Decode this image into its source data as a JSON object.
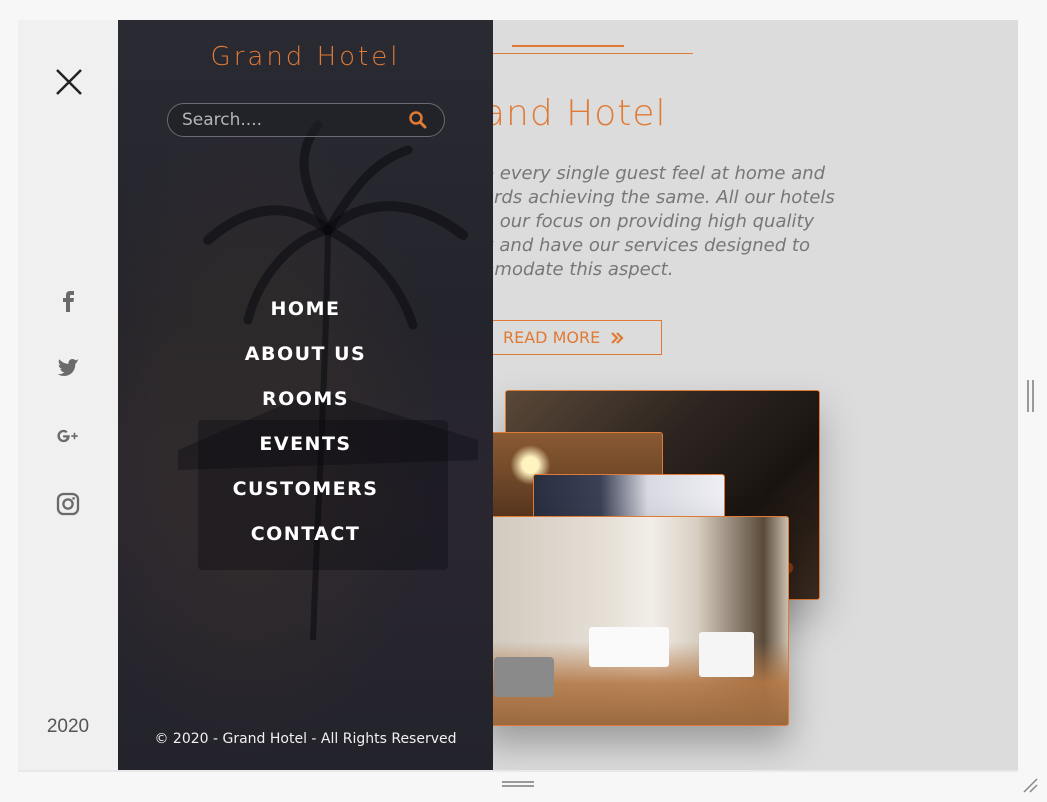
{
  "drawer": {
    "title": "Grand Hotel",
    "search_placeholder": "Search....",
    "nav": [
      "HOME",
      "ABOUT US",
      "ROOMS",
      "EVENTS",
      "CUSTOMERS",
      "CONTACT"
    ],
    "footer": "© 2020 - Grand Hotel - All Rights Reserved"
  },
  "rail": {
    "year": "2020",
    "social_icons": [
      "facebook-icon",
      "twitter-icon",
      "google-plus-icon",
      "instagram-icon"
    ]
  },
  "hero": {
    "title": "and Hotel",
    "description_lines": [
      "e every single guest feel at home and",
      "ards achieving the same. All our hotels",
      "o our focus on providing high quality",
      "y and have our services designed to",
      "nmodate this aspect."
    ],
    "read_more": "READ MORE"
  },
  "colors": {
    "accent": "#e07a35",
    "drawer_bg": "#26262e",
    "page_bg": "#dcdcdc",
    "rail_bg": "#f0f0f0"
  }
}
